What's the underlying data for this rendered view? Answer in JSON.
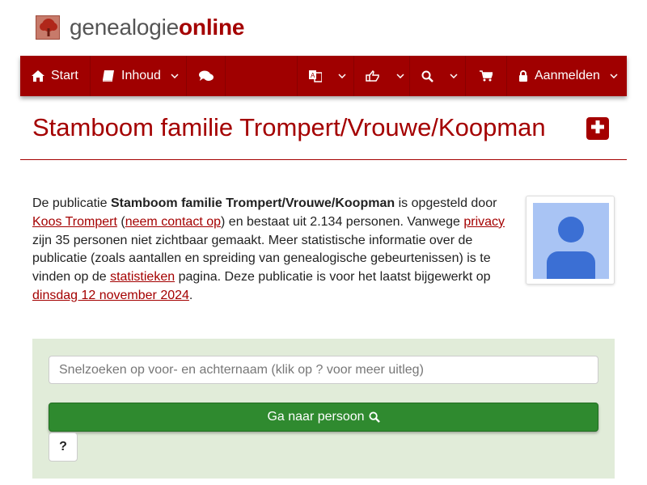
{
  "brand": {
    "name_part1": "genealogie",
    "name_part2": "online"
  },
  "nav": {
    "start": "Start",
    "inhoud": "Inhoud",
    "aanmelden": "Aanmelden",
    "icons": [
      "home-icon",
      "book-icon",
      "chat-icon",
      "translate-icon",
      "share-icon",
      "search-icon",
      "cart-icon",
      "lock-icon"
    ]
  },
  "page": {
    "title": "Stamboom familie Trompert/Vrouwe/Koopman"
  },
  "intro": {
    "t1": "De publicatie ",
    "pub_name": "Stamboom familie Trompert/Vrouwe/Koopman",
    "t2": " is opgesteld door ",
    "author": "Koos Trompert",
    "t3": " (",
    "contact": "neem contact op",
    "t4": ") en bestaat uit 2.134 personen. Vanwege ",
    "privacy": "privacy",
    "t5": " zijn 35 personen niet zichtbaar gemaakt. Meer statistische informatie over de publicatie (zoals aantallen en spreiding van genealogische gebeurtenissen) is te vinden op de ",
    "stats": "statistieken",
    "t6": " pagina. Deze publicatie is voor het laatst bijgewerkt op ",
    "date": "dinsdag 12 november 2024",
    "t7": "."
  },
  "search": {
    "placeholder": "Snelzoeken op voor- en achternaam (klik op ? voor meer uitleg)",
    "go_label": "Ga naar persoon",
    "help_label": "?"
  },
  "colors": {
    "brand_red": "#a40000",
    "nav_bg": "#a00000",
    "panel_bg": "#e1ecd9",
    "button_green": "#2f8a2f",
    "avatar_bg": "#a9c4f4",
    "avatar_fg": "#3b6fd4"
  }
}
